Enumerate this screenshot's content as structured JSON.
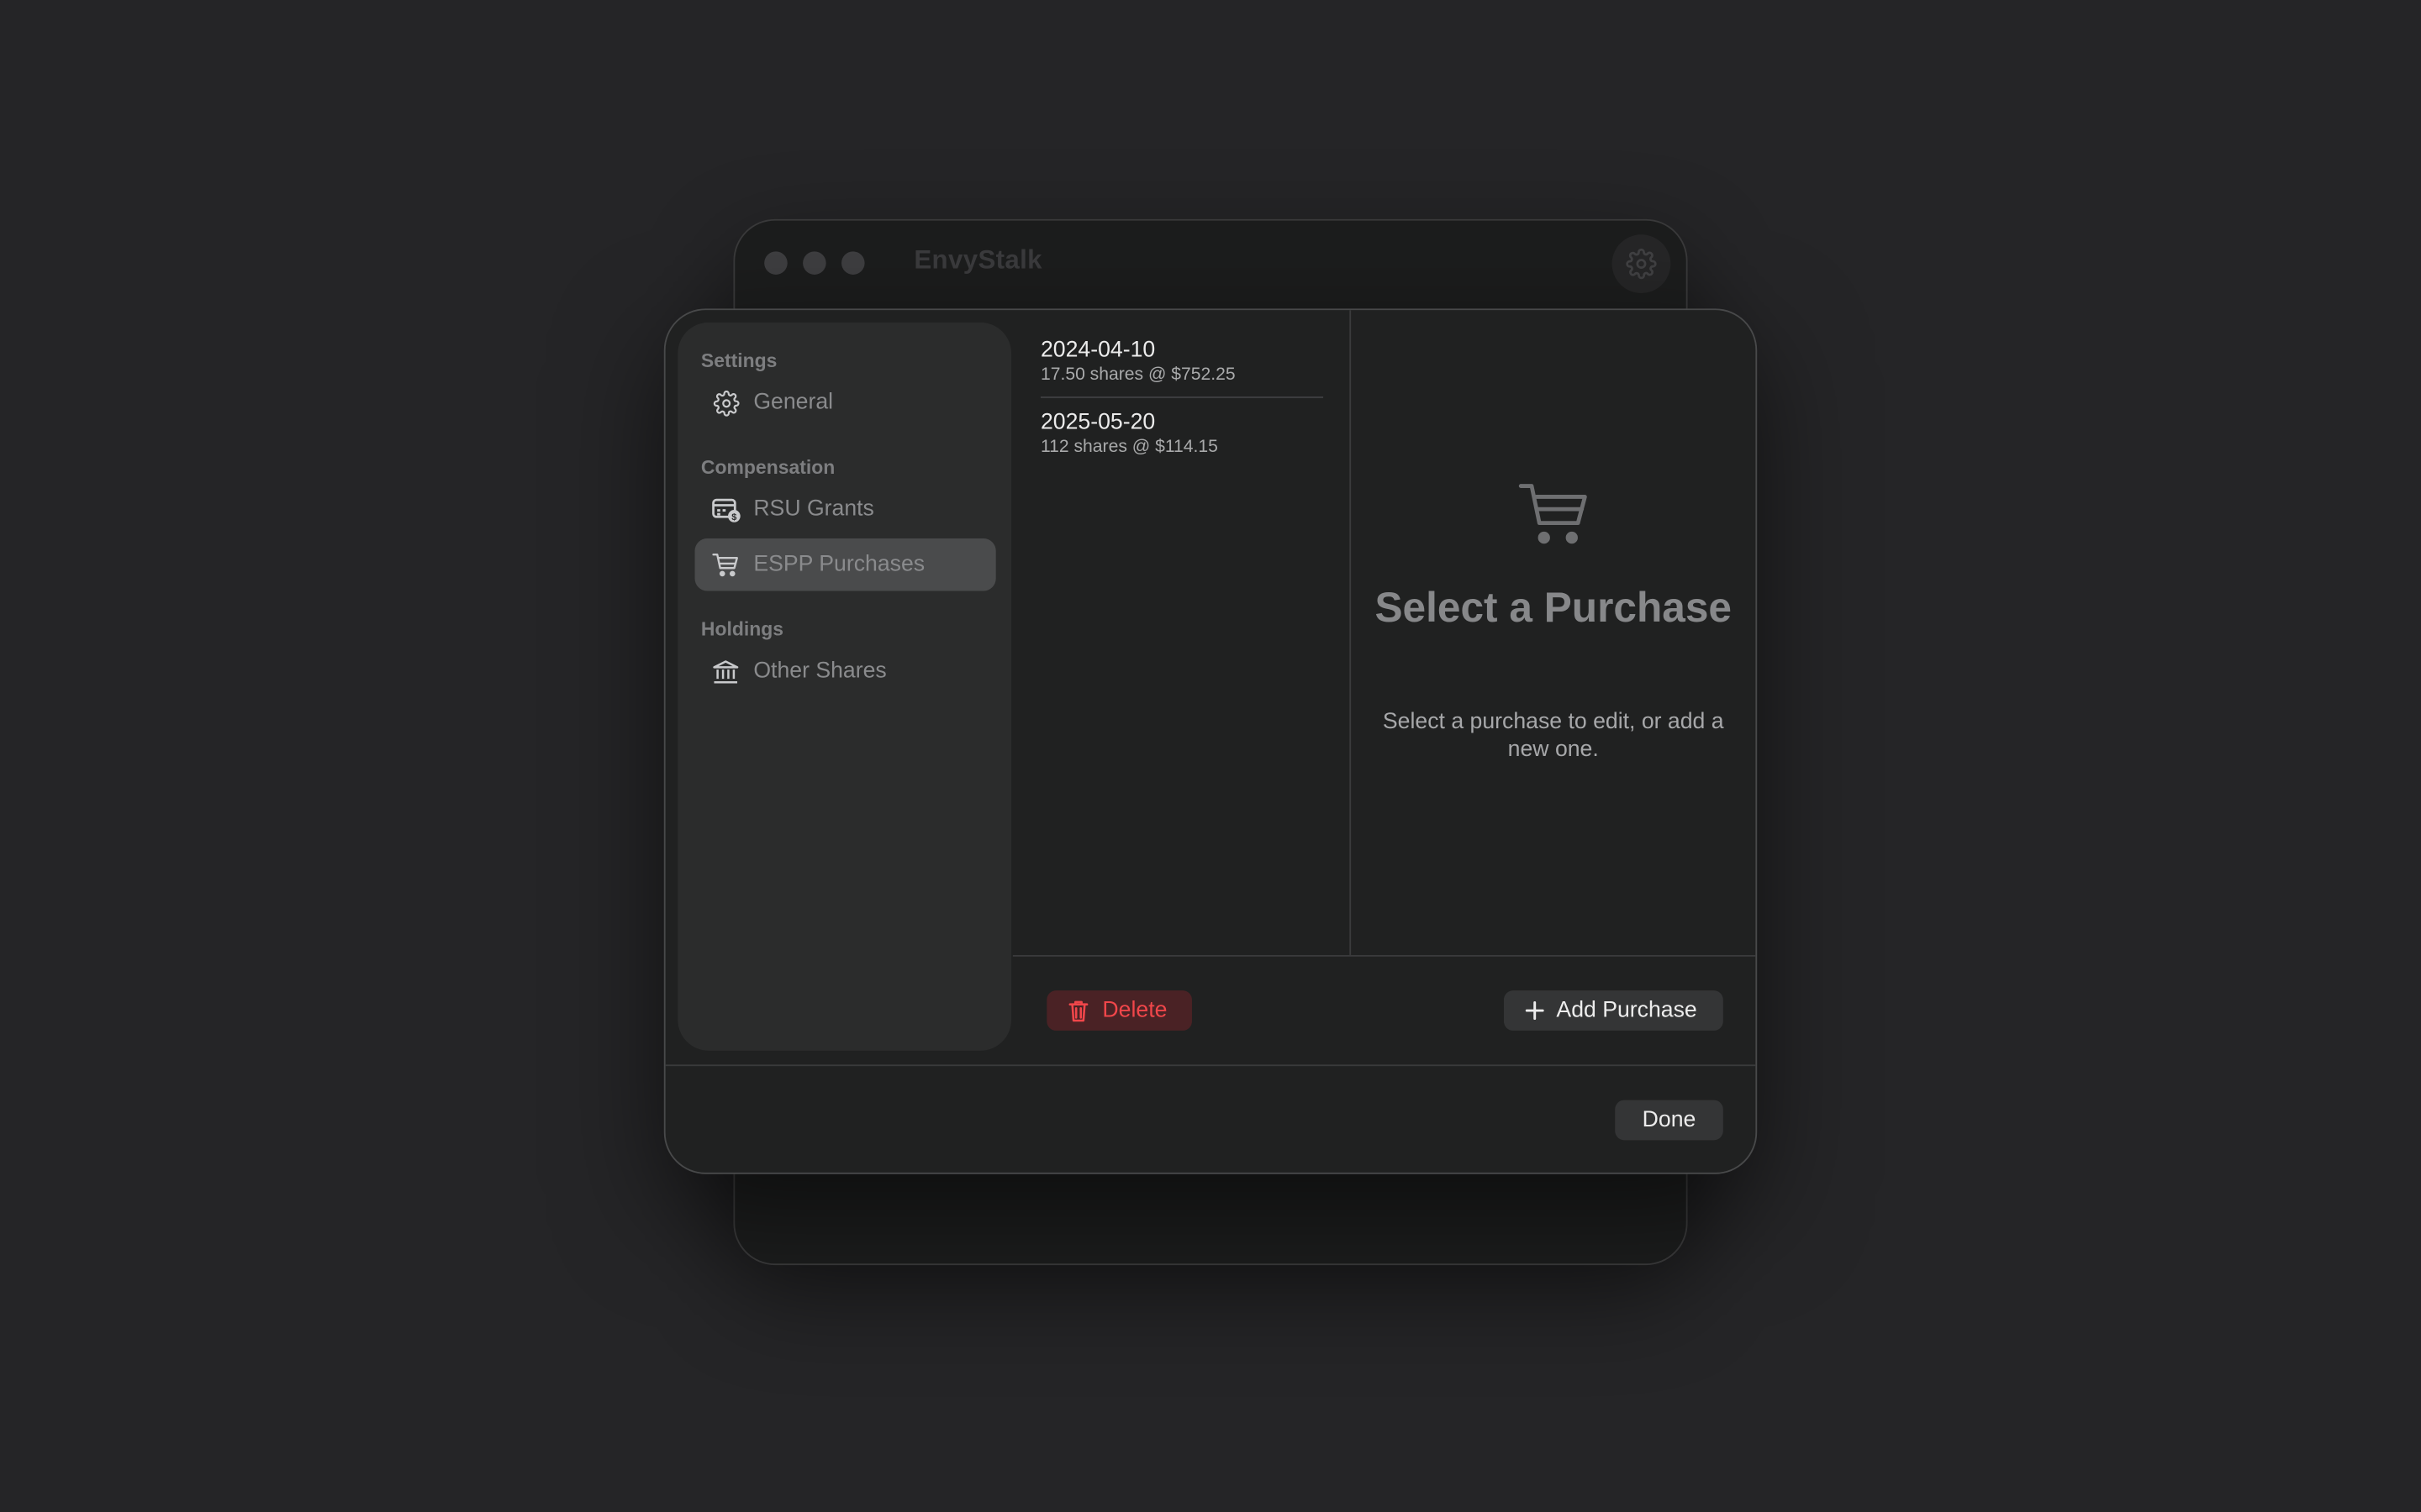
{
  "window": {
    "title": "EnvyStalk"
  },
  "sidebar": {
    "sections": [
      {
        "label": "Settings"
      },
      {
        "label": "Compensation"
      },
      {
        "label": "Holdings"
      }
    ],
    "items": [
      {
        "label": "General",
        "icon": "gear-icon",
        "selected": false
      },
      {
        "label": "RSU Grants",
        "icon": "calendar-badge-icon",
        "selected": false
      },
      {
        "label": "ESPP Purchases",
        "icon": "cart-icon",
        "selected": true
      },
      {
        "label": "Other Shares",
        "icon": "bank-icon",
        "selected": false
      }
    ]
  },
  "purchases": [
    {
      "date": "2024-04-10",
      "detail": "17.50 shares @ $752.25"
    },
    {
      "date": "2025-05-20",
      "detail": "112 shares @ $114.15"
    }
  ],
  "empty_state": {
    "icon": "cart-icon",
    "title": "Select a Purchase",
    "subtitle": "Select a purchase to edit, or add a new one."
  },
  "actions": {
    "delete_label": "Delete",
    "add_label": "Add Purchase",
    "done_label": "Done"
  },
  "colors": {
    "background": "#252527",
    "sheet": "#202121",
    "sidebar": "#2b2c2c",
    "selection": "#4a4b4c",
    "destructive": "#f0464a",
    "destructive_bg": "#4a2225"
  }
}
